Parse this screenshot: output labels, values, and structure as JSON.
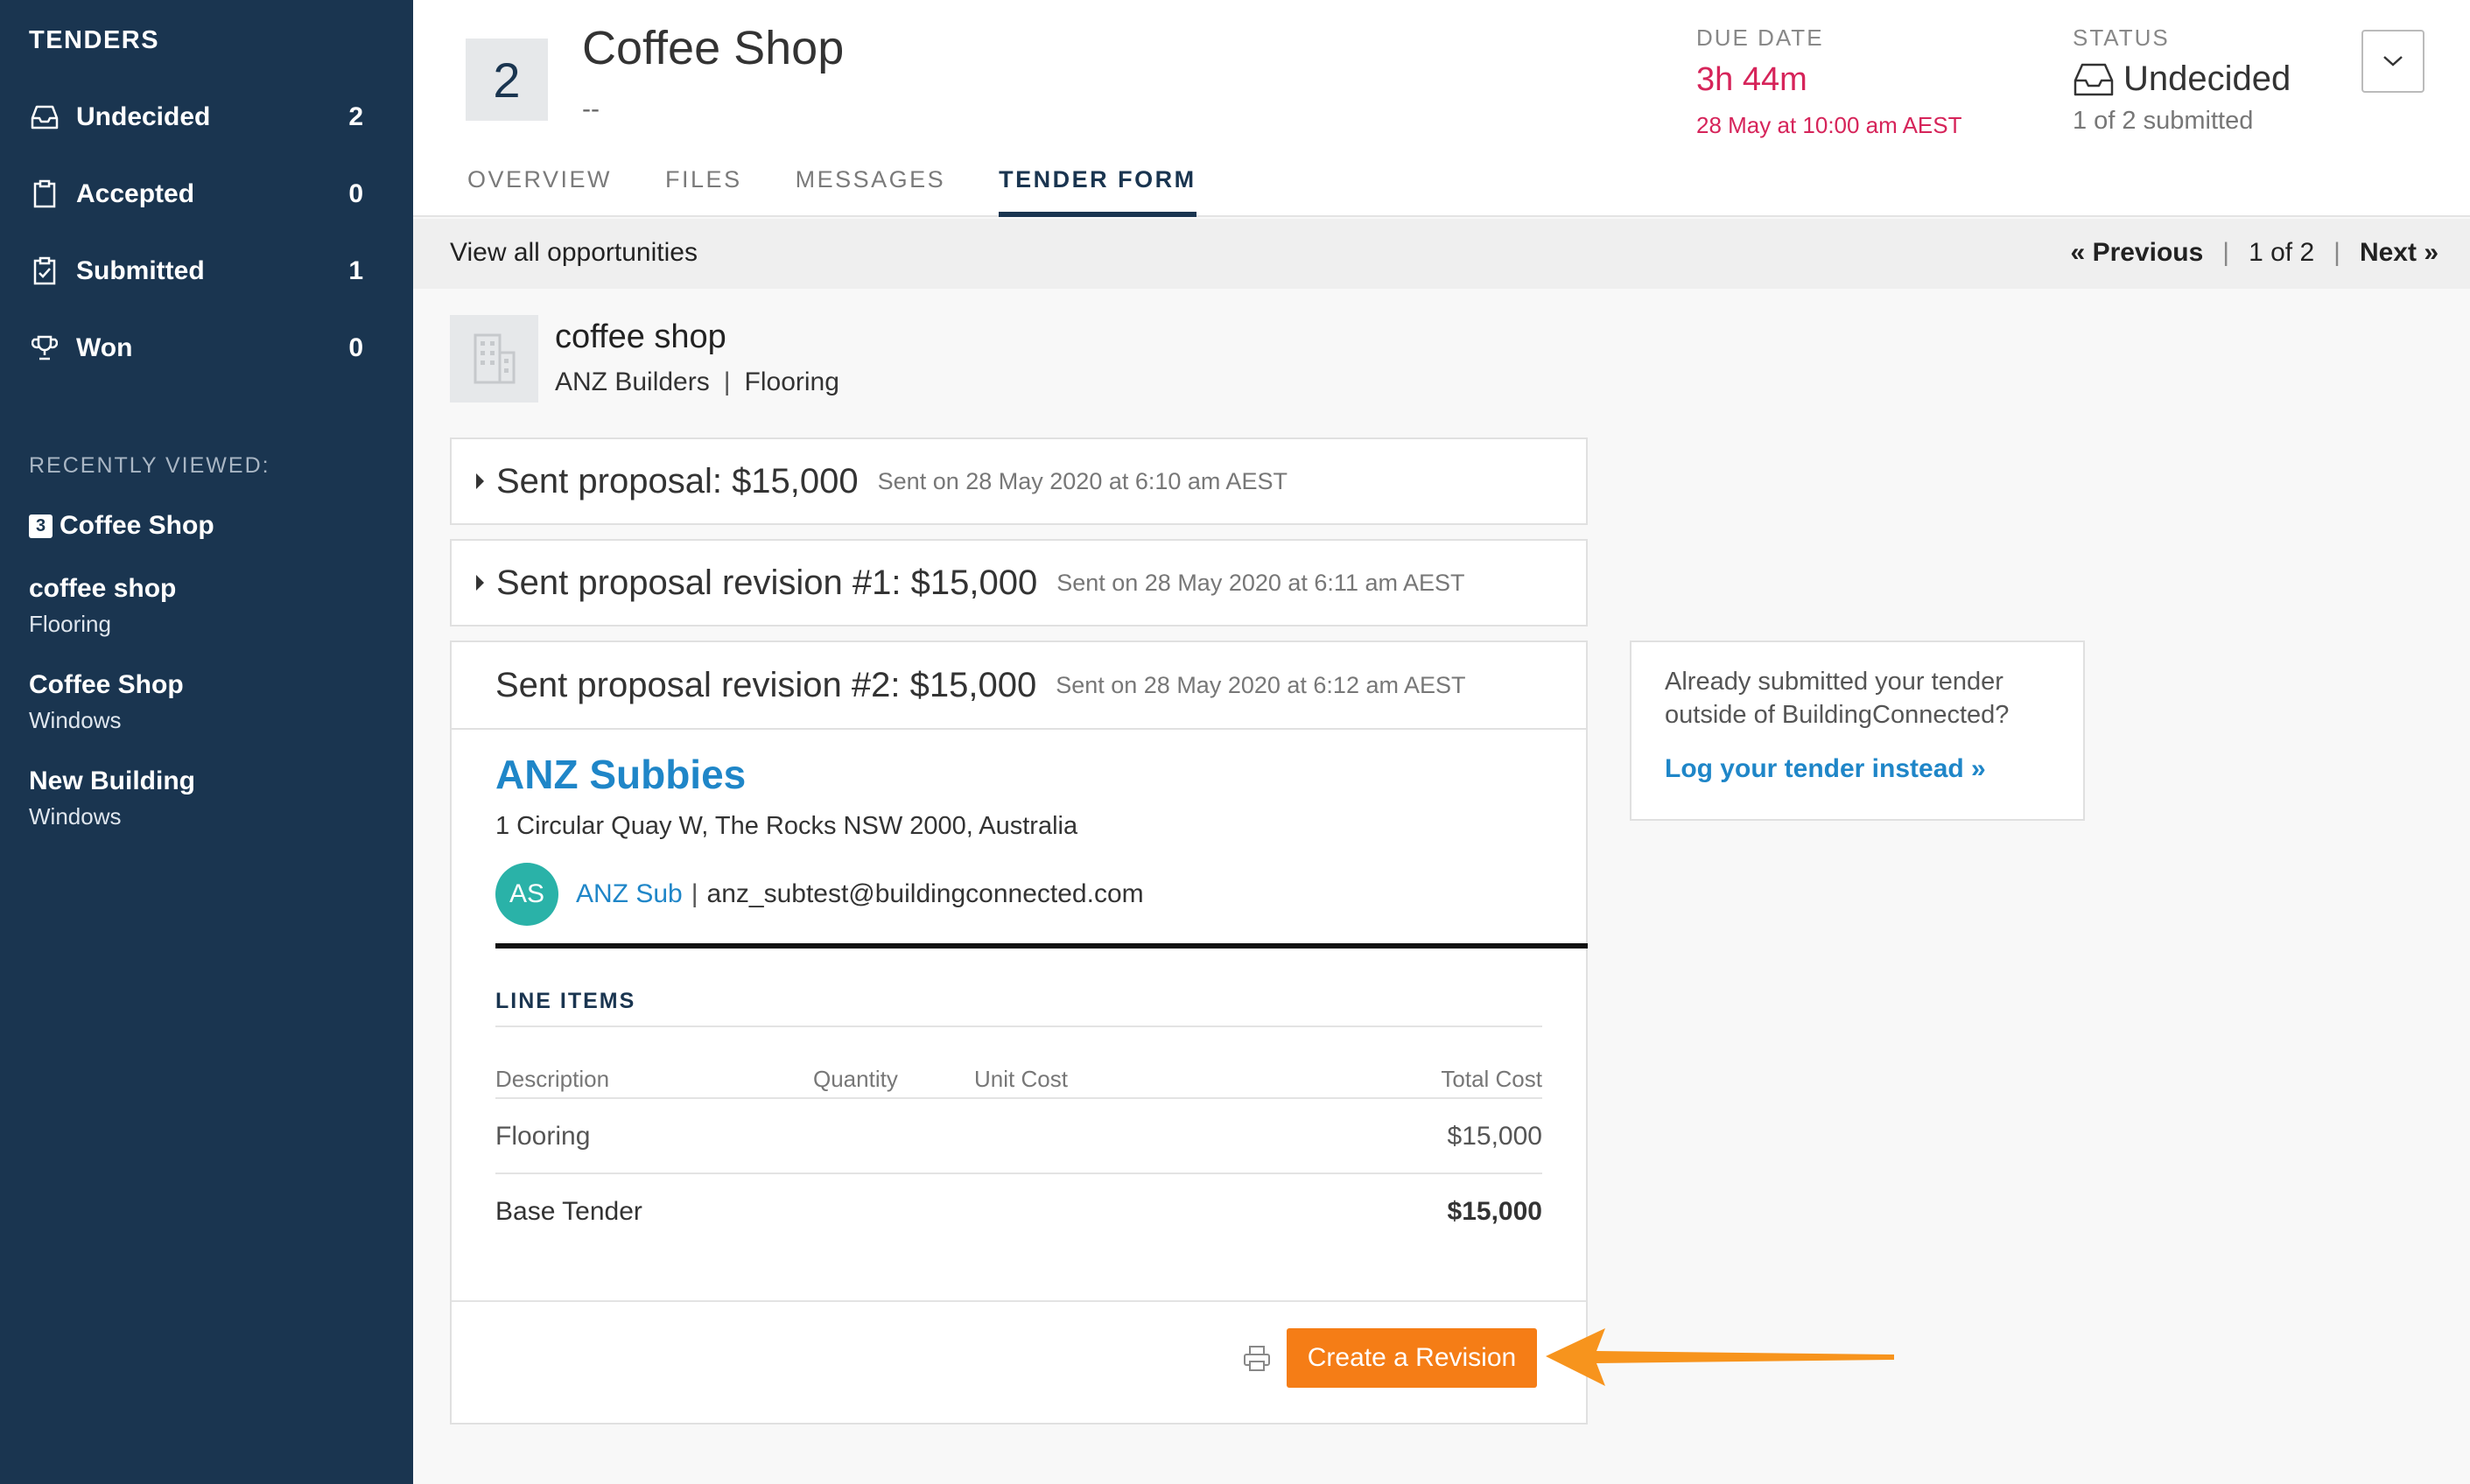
{
  "sidebar": {
    "title": "TENDERS",
    "items": [
      {
        "label": "Undecided",
        "count": "2",
        "icon": "inbox-icon"
      },
      {
        "label": "Accepted",
        "count": "0",
        "icon": "clipboard-icon"
      },
      {
        "label": "Submitted",
        "count": "1",
        "icon": "clipboard-check-icon"
      },
      {
        "label": "Won",
        "count": "0",
        "icon": "trophy-icon"
      }
    ],
    "recent_heading": "RECENTLY VIEWED:",
    "recent": [
      {
        "badge": "3",
        "title": "Coffee Shop",
        "subtitle": ""
      },
      {
        "title": "coffee shop",
        "subtitle": "Flooring"
      },
      {
        "title": "Coffee Shop",
        "subtitle": "Windows"
      },
      {
        "title": "New Building",
        "subtitle": "Windows"
      }
    ]
  },
  "header": {
    "number": "2",
    "title": "Coffee Shop",
    "subtitle": "--",
    "tabs": [
      {
        "label": "OVERVIEW",
        "active": false
      },
      {
        "label": "FILES",
        "active": false
      },
      {
        "label": "MESSAGES",
        "active": false
      },
      {
        "label": "TENDER FORM",
        "active": true
      }
    ],
    "due": {
      "heading": "DUE DATE",
      "value": "3h 44m",
      "date": "28 May at 10:00 am AEST",
      "color": "#d6245a"
    },
    "status": {
      "heading": "STATUS",
      "value": "Undecided",
      "sub": "1 of 2 submitted"
    }
  },
  "subbar": {
    "view_all": "View all opportunities",
    "prev": "« Previous",
    "page": "1 of 2",
    "next": "Next »"
  },
  "project": {
    "name": "coffee shop",
    "company": "ANZ Builders",
    "trade": "Flooring"
  },
  "proposals": [
    {
      "title": "Sent proposal: $15,000",
      "date": "Sent on 28 May 2020 at 6:10 am AEST"
    },
    {
      "title": "Sent proposal revision #1: $15,000",
      "date": "Sent on 28 May 2020 at 6:11 am AEST"
    },
    {
      "title": "Sent proposal revision #2: $15,000",
      "date": "Sent on 28 May 2020 at 6:12 am AEST"
    }
  ],
  "bidder": {
    "name": "ANZ Subbies",
    "address": "1 Circular Quay W, The Rocks NSW 2000, Australia",
    "initials": "AS",
    "contact": "ANZ Sub",
    "email": "anz_subtest@buildingconnected.com"
  },
  "line_items": {
    "heading": "LINE ITEMS",
    "columns": [
      "Description",
      "Quantity",
      "Unit Cost",
      "Total Cost"
    ],
    "rows": [
      {
        "description": "Flooring",
        "total": "$15,000"
      }
    ],
    "base": {
      "label": "Base Tender",
      "total": "$15,000"
    }
  },
  "actions": {
    "create_revision": "Create a Revision"
  },
  "side_card": {
    "question": "Already submitted your tender outside of BuildingConnected?",
    "link": "Log your tender instead »"
  },
  "colors": {
    "sidebar": "#1a3550",
    "accent": "#1f86c8",
    "cta": "#f57d16",
    "due": "#d6245a"
  }
}
